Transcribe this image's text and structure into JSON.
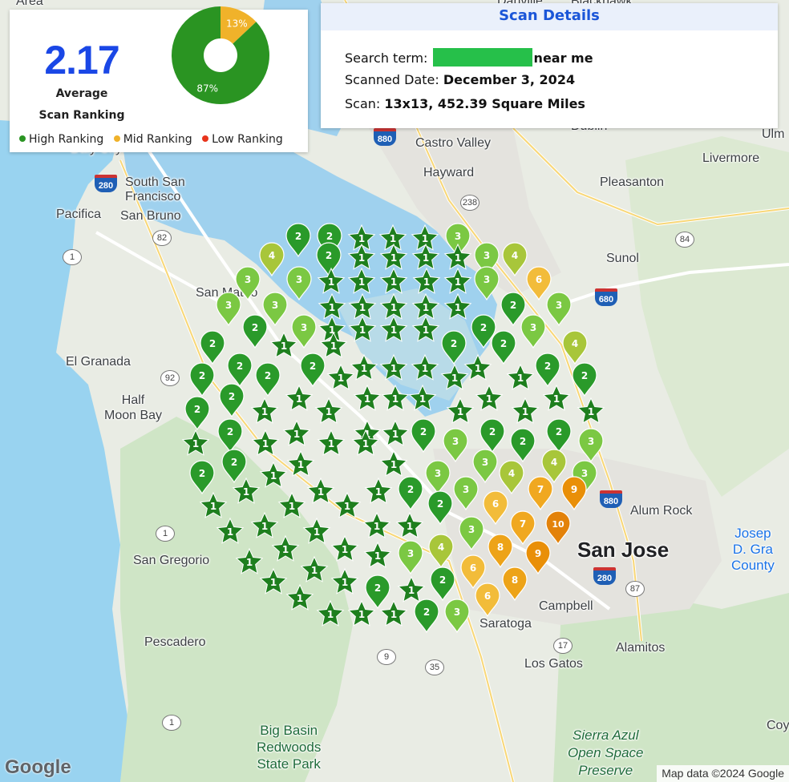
{
  "summary": {
    "average_value": "2.17",
    "average_label": "Average\nScan Ranking",
    "donut": {
      "segments": [
        {
          "label": "87%",
          "percent": 87,
          "color": "#2a9422"
        },
        {
          "label": "13%",
          "percent": 13,
          "color": "#f0b22a"
        }
      ]
    },
    "legend": [
      {
        "label": "High Ranking",
        "color": "#2a9422"
      },
      {
        "label": "Mid Ranking",
        "color": "#f0b22a"
      },
      {
        "label": "Low Ranking",
        "color": "#e8341c"
      }
    ]
  },
  "details": {
    "title": "Scan Details",
    "search_term_label": "Search term:",
    "search_term_suffix": "near me",
    "date_label": "Scanned Date:",
    "date_value": "December 3, 2024",
    "scan_label": "Scan:",
    "scan_value": "13x13, 452.39 Square Miles"
  },
  "pin_colors": {
    "1": "#1e7f1e",
    "2": "#2a9a2a",
    "3": "#7bc843",
    "4": "#a8c63a",
    "5": "#c9c233",
    "6": "#f2bc3a",
    "7": "#f0a820",
    "8": "#eda318",
    "9": "#e98f08",
    "10": "#e3820a"
  },
  "map_labels": {
    "castro_valley": "Castro Valley",
    "hayward": "Hayward",
    "livermore": "Livermore",
    "pleasanton": "Pleasanton",
    "sunol": "Sunol",
    "south_san_francisco": "South San\nFrancisco",
    "pacifica": "Pacifica",
    "san_bruno": "San Bruno",
    "san_mateo": "San Mateo",
    "el_granada": "El Granada",
    "half_moon_bay": "Half\nMoon Bay",
    "san_gregorio": "San Gregorio",
    "pescadero": "Pescadero",
    "alum_rock": "Alum Rock",
    "san_jose": "San Jose",
    "campbell": "Campbell",
    "saratoga": "Saratoga",
    "alamitos": "Alamitos",
    "los_gatos": "Los Gatos",
    "big_basin": "Big Basin\nRedwoods\nState Park",
    "sierra_azul": "Sierra Azul\nOpen Space\nPreserve",
    "jose_county": "Josep\nD. Gra\nCounty",
    "coy": "Coy",
    "ulm": "Ulm",
    "daly_city": "Daly City",
    "dublin": "Dublin",
    "area": "Area",
    "blackhawk": "Blackhawk",
    "danville": "Danville"
  },
  "shields": {
    "s880": "880",
    "s238": "238",
    "s280": "280",
    "s82": "82",
    "s1a": "1",
    "s92": "92",
    "s84": "84",
    "s680": "680",
    "s87": "87",
    "s17": "17",
    "s9": "9",
    "s35": "35",
    "s1b": "1",
    "s1c": "1",
    "s880b": "880",
    "s280b": "280"
  },
  "google_logo": "Google",
  "attribution": "Map data ©2024 Google"
}
